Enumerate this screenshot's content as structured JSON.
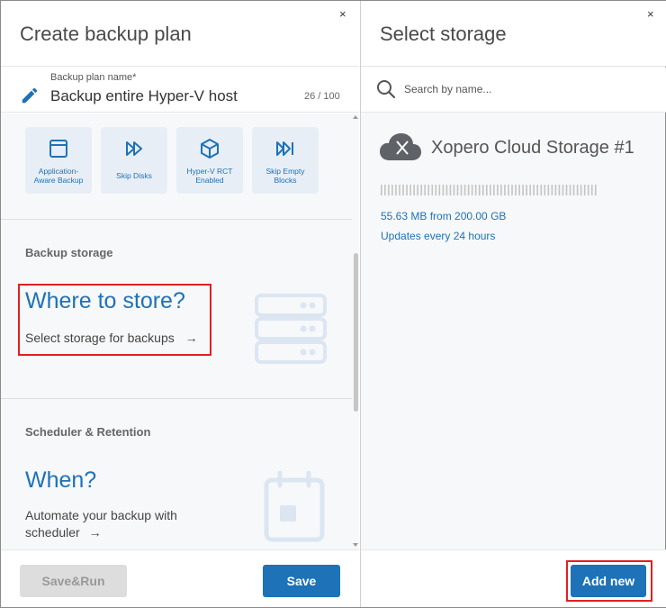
{
  "left_panel": {
    "title": "Create backup plan",
    "close_glyph": "×",
    "plan_name": {
      "label": "Backup plan name*",
      "value": "Backup entire Hyper-V host",
      "counter": "26 / 100"
    },
    "options": [
      {
        "label_line1": "Application-",
        "label_line2": "Aware Backup",
        "icon": "window-icon"
      },
      {
        "label_line1": "Skip Disks",
        "label_line2": "",
        "icon": "fast-forward-icon"
      },
      {
        "label_line1": "Hyper-V RCT",
        "label_line2": "Enabled",
        "icon": "cube-icon"
      },
      {
        "label_line1": "Skip Empty",
        "label_line2": "Blocks",
        "icon": "skip-forward-icon"
      }
    ],
    "storage_section": {
      "label": "Backup storage",
      "question": "Where to store?",
      "link": "Select storage for backups"
    },
    "scheduler_section": {
      "label": "Scheduler & Retention",
      "question": "When?",
      "link_line1": "Automate your backup with",
      "link_line2": "scheduler"
    },
    "buttons": {
      "save_run": "Save&Run",
      "save": "Save"
    },
    "arrow_glyph": "→"
  },
  "right_panel": {
    "title": "Select storage",
    "close_glyph": "×",
    "search_placeholder": "Search by name...",
    "storage": {
      "name": "Xopero Cloud Storage #1",
      "usage": "55.63 MB from 200.00 GB",
      "updates": "Updates every 24 hours",
      "usage_fraction": 0.0003
    },
    "buttons": {
      "add_new": "Add new"
    }
  },
  "colors": {
    "accent": "#1d72b8",
    "highlight": "#e02020",
    "tile_bg": "#e8eef6",
    "icon_gray": "#5f6368"
  }
}
